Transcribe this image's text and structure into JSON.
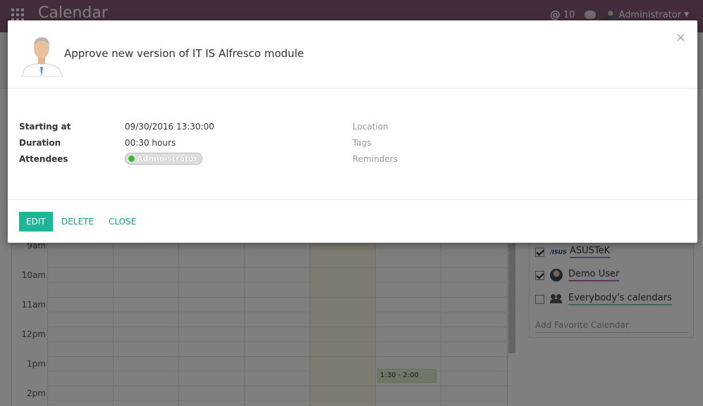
{
  "app": {
    "title": "Calendar",
    "mentions_count": "10",
    "user_name": "Administrator"
  },
  "calendar": {
    "hours": [
      "9am",
      "10am",
      "11am",
      "12pm",
      "1pm",
      "2pm"
    ],
    "event_label": "1:30 - 2:00"
  },
  "sidebar": {
    "items": [
      {
        "label": "ASUSTeK",
        "checked": true,
        "color": "#8c86c7"
      },
      {
        "label": "Demo User",
        "checked": true,
        "color": "#c76aa6"
      },
      {
        "label": "Everybody's calendars",
        "checked": false,
        "color": "#8bc9b0"
      }
    ],
    "add_favorite_placeholder": "Add Favorite Calendar"
  },
  "modal": {
    "title": "Approve new version of IT IS Alfresco module",
    "close_symbol": "×",
    "fields": {
      "starting_at_label": "Starting at",
      "starting_at_value": "09/30/2016 13:30:00",
      "duration_label": "Duration",
      "duration_value": "00:30 hours",
      "attendees_label": "Attendees",
      "attendee_name": "Administrator",
      "location_label": "Location",
      "tags_label": "Tags",
      "reminders_label": "Reminders"
    },
    "buttons": {
      "edit": "EDIT",
      "delete": "DELETE",
      "close": "CLOSE"
    }
  },
  "colors": {
    "brand": "#875a7b",
    "primary_button": "#1fb598",
    "link": "#1a9e8c",
    "attendee_status": "#3ab83a"
  }
}
